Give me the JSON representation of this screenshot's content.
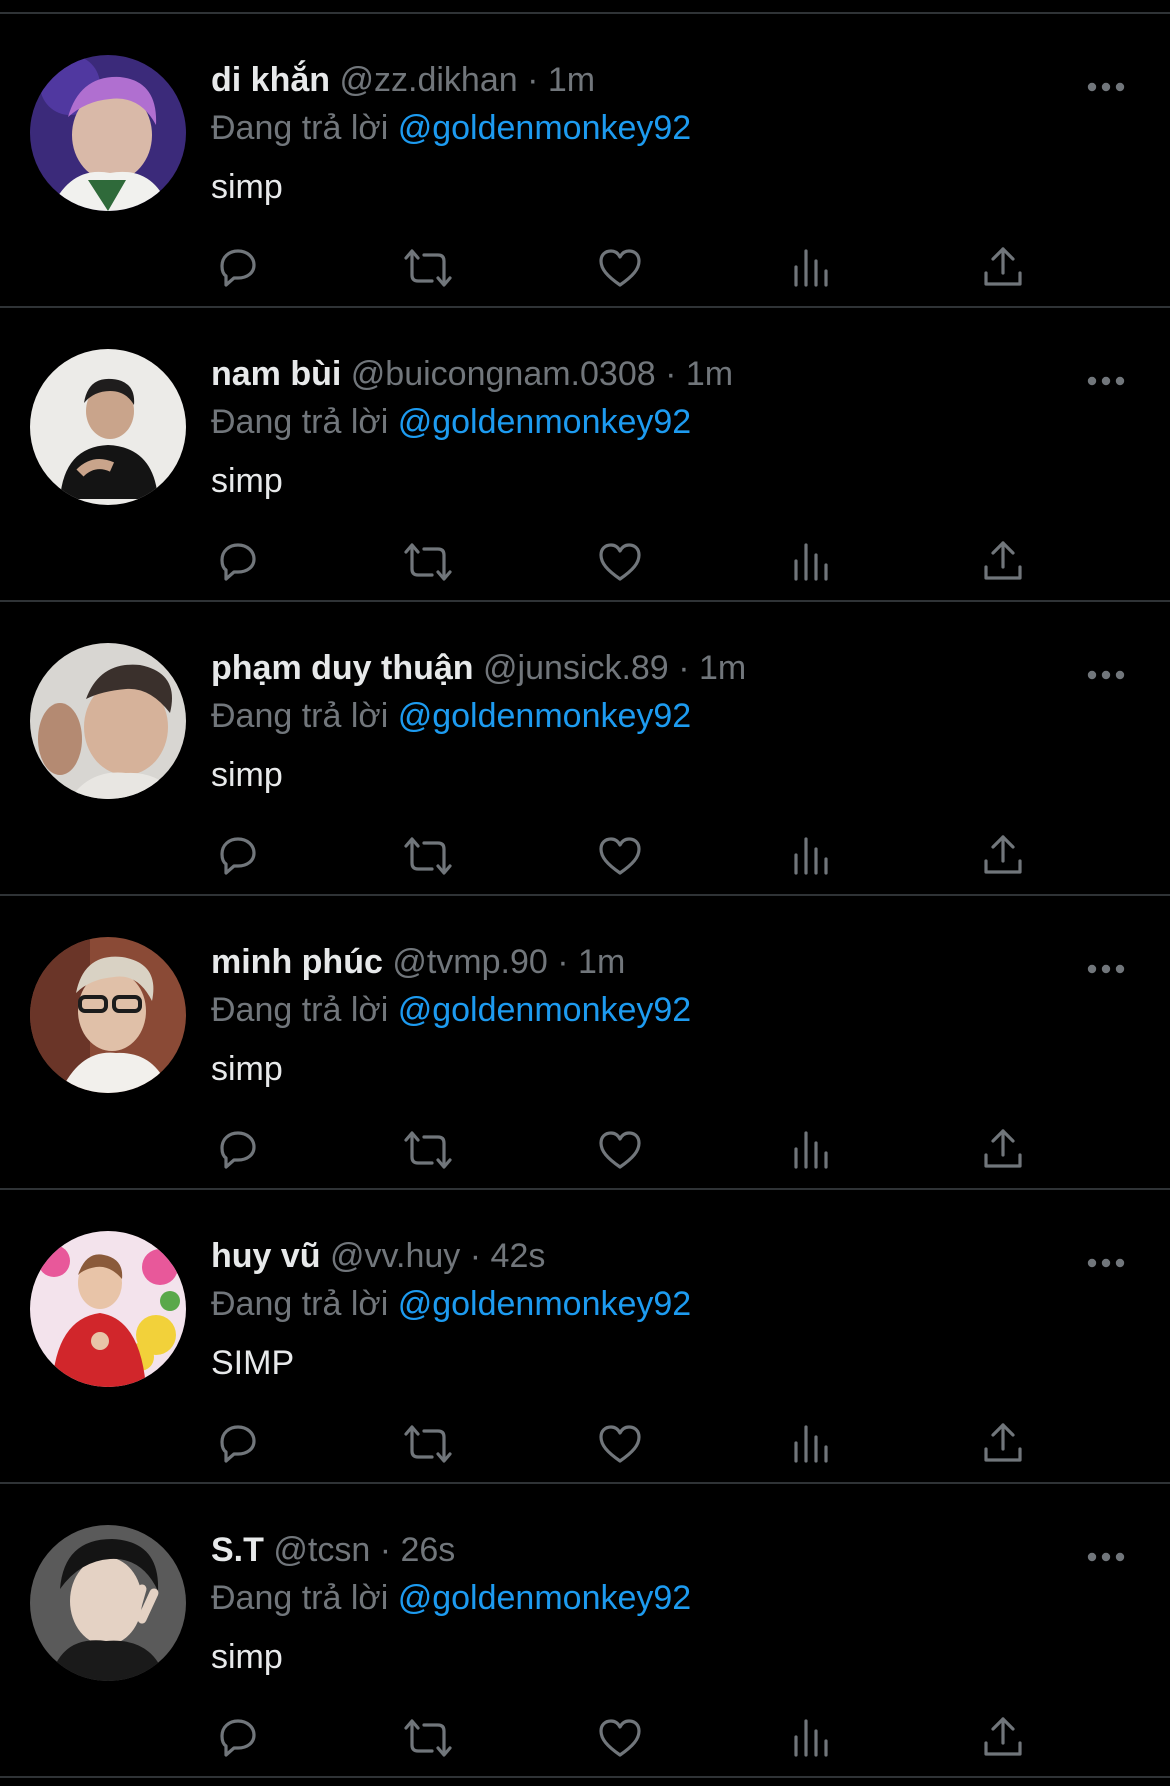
{
  "accent_color": "#1d9bf0",
  "separator": "·",
  "icons": {
    "more": "more-horizontal-icon",
    "reply": "reply-icon",
    "retweet": "retweet-icon",
    "like": "heart-icon",
    "views": "views-icon",
    "share": "share-icon"
  },
  "tweets": [
    {
      "name": "di khắn",
      "handle": "@zz.dikhan",
      "time": "1m",
      "reply_prefix": "Đang trả lời",
      "reply_to": "@goldenmonkey92",
      "text": "simp"
    },
    {
      "name": "nam bùi",
      "handle": "@buicongnam.0308",
      "time": "1m",
      "reply_prefix": "Đang trả lời",
      "reply_to": "@goldenmonkey92",
      "text": "simp"
    },
    {
      "name": "phạm duy thuận",
      "handle": "@junsick.89",
      "time": "1m",
      "reply_prefix": "Đang trả lời",
      "reply_to": "@goldenmonkey92",
      "text": "simp"
    },
    {
      "name": "minh phúc",
      "handle": "@tvmp.90",
      "time": "1m",
      "reply_prefix": "Đang trả lời",
      "reply_to": "@goldenmonkey92",
      "text": "simp"
    },
    {
      "name": "huy vũ",
      "handle": "@vv.huy",
      "time": "42s",
      "reply_prefix": "Đang trả lời",
      "reply_to": "@goldenmonkey92",
      "text": "SIMP"
    },
    {
      "name": "S.T",
      "handle": "@tcsn",
      "time": "26s",
      "reply_prefix": "Đang trả lời",
      "reply_to": "@goldenmonkey92",
      "text": "simp"
    }
  ]
}
